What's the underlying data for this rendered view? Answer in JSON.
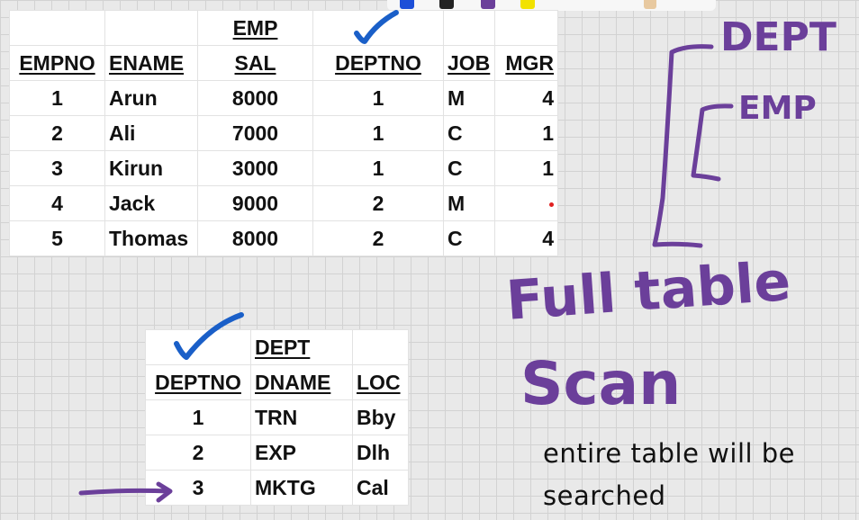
{
  "emp_table": {
    "title": "EMP",
    "headers": [
      "EMPNO",
      "ENAME",
      "SAL",
      "DEPTNO",
      "JOB",
      "MGR"
    ],
    "rows": [
      [
        "1",
        "Arun",
        "8000",
        "1",
        "M",
        "4"
      ],
      [
        "2",
        "Ali",
        "7000",
        "1",
        "C",
        "1"
      ],
      [
        "3",
        "Kirun",
        "3000",
        "1",
        "C",
        "1"
      ],
      [
        "4",
        "Jack",
        "9000",
        "2",
        "M",
        ""
      ],
      [
        "5",
        "Thomas",
        "8000",
        "2",
        "C",
        "4"
      ]
    ]
  },
  "dept_table": {
    "title": "DEPT",
    "headers": [
      "DEPTNO",
      "DNAME",
      "LOC"
    ],
    "rows": [
      [
        "1",
        "TRN",
        "Bby"
      ],
      [
        "2",
        "EXP",
        "Dlh"
      ],
      [
        "3",
        "MKTG",
        "Cal"
      ]
    ]
  },
  "annotations": {
    "hierarchy_top": "DEPT",
    "hierarchy_child": "EMP",
    "scan_line1": "Full table",
    "scan_line2": "Scan",
    "note_line1": "entire table will be",
    "note_line2": "searched"
  },
  "colors": {
    "ink_purple": "#6b3f9a",
    "check_blue": "#1a5fc8",
    "grid_line": "#d2d2d2",
    "background": "#e9e9e9",
    "null_marker_red": "#e02020"
  }
}
